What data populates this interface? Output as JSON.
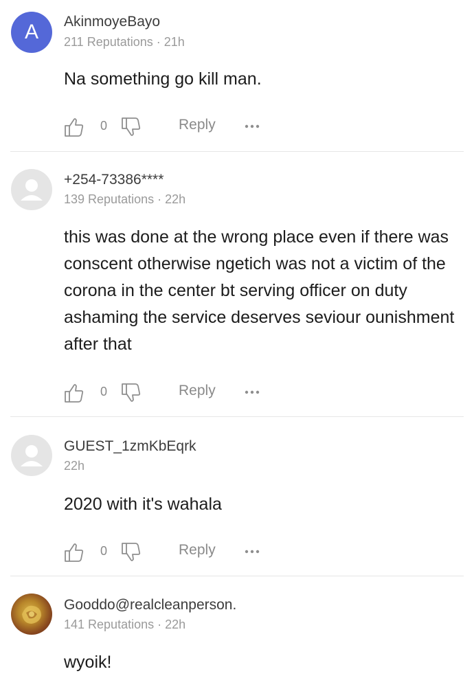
{
  "comments": [
    {
      "avatar_letter": "A",
      "username": "AkinmoyeBayo",
      "meta": "211 Reputations · 21h",
      "text": "Na something go kill man.",
      "likes": "0",
      "reply_label": "Reply"
    },
    {
      "username": "+254-73386****",
      "meta": "139 Reputations · 22h",
      "text": "this was done at the wrong place even if there was conscent otherwise ngetich was not a victim of the corona in the center bt serving officer on duty ashaming the service deserves seviour ounishment after that",
      "likes": "0",
      "reply_label": "Reply"
    },
    {
      "username": "GUEST_1zmKbEqrk",
      "meta": "22h",
      "text": "2020 with it's wahala",
      "likes": "0",
      "reply_label": "Reply"
    },
    {
      "username": "Gooddo@realcleanperson.",
      "meta": "141 Reputations · 22h",
      "text": "wyoik!"
    }
  ],
  "colors": {
    "avatar_accent": "#5468d8",
    "divider": "#e6e6e6",
    "secondary_text": "#9a9a9a"
  },
  "icons": {
    "like": "thumbs-up-icon",
    "dislike": "thumbs-down-icon",
    "more": "more-dots-icon",
    "guest_avatar": "person-silhouette-icon"
  }
}
